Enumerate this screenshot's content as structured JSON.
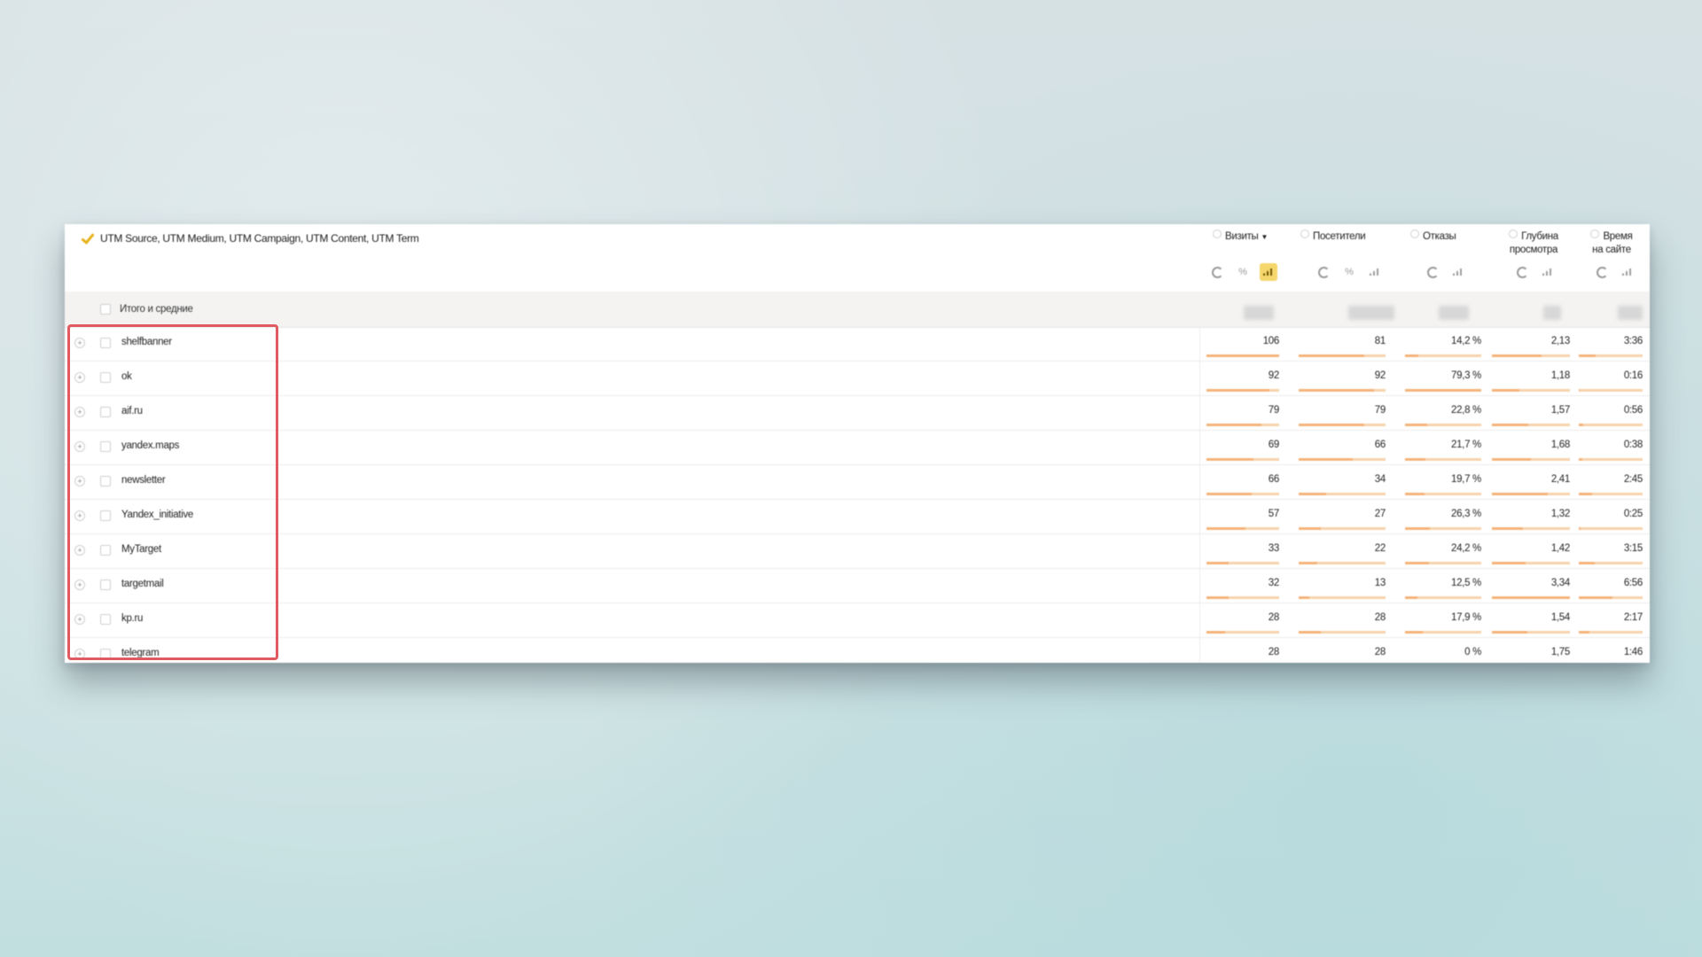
{
  "header": {
    "dimensions_label": "UTM Source, UTM Medium, UTM Campaign, UTM Content, UTM Term",
    "metrics": [
      {
        "label": "Визиты",
        "sorted": true,
        "caret": "▼"
      },
      {
        "label": "Посетители"
      },
      {
        "label": "Отказы"
      },
      {
        "label": "Глубина просмотра",
        "line1": "Глубина",
        "line2": "просмотра"
      },
      {
        "label": "Время на сайте",
        "line1": "Время",
        "line2": "на сайте"
      }
    ],
    "controls": {
      "percent_glyph": "%"
    }
  },
  "total_row": {
    "label": "Итого и средние"
  },
  "rows": [
    {
      "name": "shelfbanner",
      "visits": "106",
      "visitors": "81",
      "bounce": "14,2 %",
      "depth": "2,13",
      "time": "3:36",
      "bars": {
        "visits": 1.0,
        "visitors": 0.76,
        "bounce": 0.18,
        "depth": 0.64,
        "time": 0.27
      }
    },
    {
      "name": "ok",
      "visits": "92",
      "visitors": "92",
      "bounce": "79,3 %",
      "depth": "1,18",
      "time": "0:16",
      "bars": {
        "visits": 0.87,
        "visitors": 0.87,
        "bounce": 1.0,
        "depth": 0.35,
        "time": 0.02
      }
    },
    {
      "name": "aif.ru",
      "visits": "79",
      "visitors": "79",
      "bounce": "22,8 %",
      "depth": "1,57",
      "time": "0:56",
      "bars": {
        "visits": 0.75,
        "visitors": 0.75,
        "bounce": 0.29,
        "depth": 0.47,
        "time": 0.07
      }
    },
    {
      "name": "yandex.maps",
      "visits": "69",
      "visitors": "66",
      "bounce": "21,7 %",
      "depth": "1,68",
      "time": "0:38",
      "bars": {
        "visits": 0.65,
        "visitors": 0.62,
        "bounce": 0.27,
        "depth": 0.5,
        "time": 0.05
      }
    },
    {
      "name": "newsletter",
      "visits": "66",
      "visitors": "34",
      "bounce": "19,7 %",
      "depth": "2,41",
      "time": "2:45",
      "bars": {
        "visits": 0.62,
        "visitors": 0.32,
        "bounce": 0.25,
        "depth": 0.72,
        "time": 0.21
      }
    },
    {
      "name": "Yandex_initiative",
      "visits": "57",
      "visitors": "27",
      "bounce": "26,3 %",
      "depth": "1,32",
      "time": "0:25",
      "bars": {
        "visits": 0.54,
        "visitors": 0.25,
        "bounce": 0.33,
        "depth": 0.4,
        "time": 0.03
      }
    },
    {
      "name": "MyTarget",
      "visits": "33",
      "visitors": "22",
      "bounce": "24,2 %",
      "depth": "1,42",
      "time": "3:15",
      "bars": {
        "visits": 0.31,
        "visitors": 0.21,
        "bounce": 0.31,
        "depth": 0.43,
        "time": 0.25
      }
    },
    {
      "name": "targetmail",
      "visits": "32",
      "visitors": "13",
      "bounce": "12,5 %",
      "depth": "3,34",
      "time": "6:56",
      "bars": {
        "visits": 0.3,
        "visitors": 0.12,
        "bounce": 0.16,
        "depth": 1.0,
        "time": 0.53
      }
    },
    {
      "name": "kp.ru",
      "visits": "28",
      "visitors": "28",
      "bounce": "17,9 %",
      "depth": "1,54",
      "time": "2:17",
      "bars": {
        "visits": 0.26,
        "visitors": 0.26,
        "bounce": 0.23,
        "depth": 0.46,
        "time": 0.17
      }
    },
    {
      "name": "telegram",
      "visits": "28",
      "visitors": "28",
      "bounce": "0 %",
      "depth": "1,75",
      "time": "1:46",
      "bars": {
        "visits": 0.26,
        "visitors": 0.26,
        "bounce": 0.0,
        "depth": 0.52,
        "time": 0.13
      }
    }
  ],
  "colors": {
    "accent": "#f5d76e",
    "bar": "#f5b37a",
    "highlight": "#e05a5f"
  }
}
